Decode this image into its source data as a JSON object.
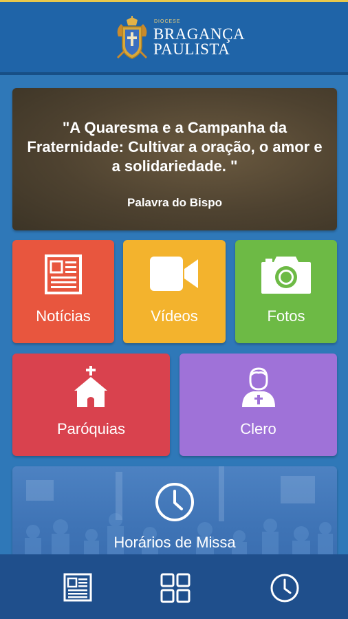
{
  "header": {
    "logo_small": "DIOCESE",
    "logo_line1": "BRAGANÇA",
    "logo_line2": "PAULISTA"
  },
  "quote": {
    "text": "\"A Quaresma e a Campanha da Fraternidade: Cultivar a oração, o amor e a solidariedade. \"",
    "source": "Palavra do Bispo"
  },
  "tiles": {
    "news": "Notícias",
    "videos": "Vídeos",
    "photos": "Fotos",
    "parishes": "Paróquias",
    "clergy": "Clero",
    "mass": "Horários de Missa"
  },
  "nav": {
    "icons": [
      "newspaper-icon",
      "grid-icon",
      "clock-icon"
    ]
  },
  "colors": {
    "background": "#2f78b8",
    "header": "#1f64a8",
    "news": "#e8563e",
    "videos": "#f3b32d",
    "photos": "#6dba45",
    "parishes": "#d9424e",
    "clergy": "#9f72d8",
    "bottom_bar": "#1f4f8c"
  }
}
